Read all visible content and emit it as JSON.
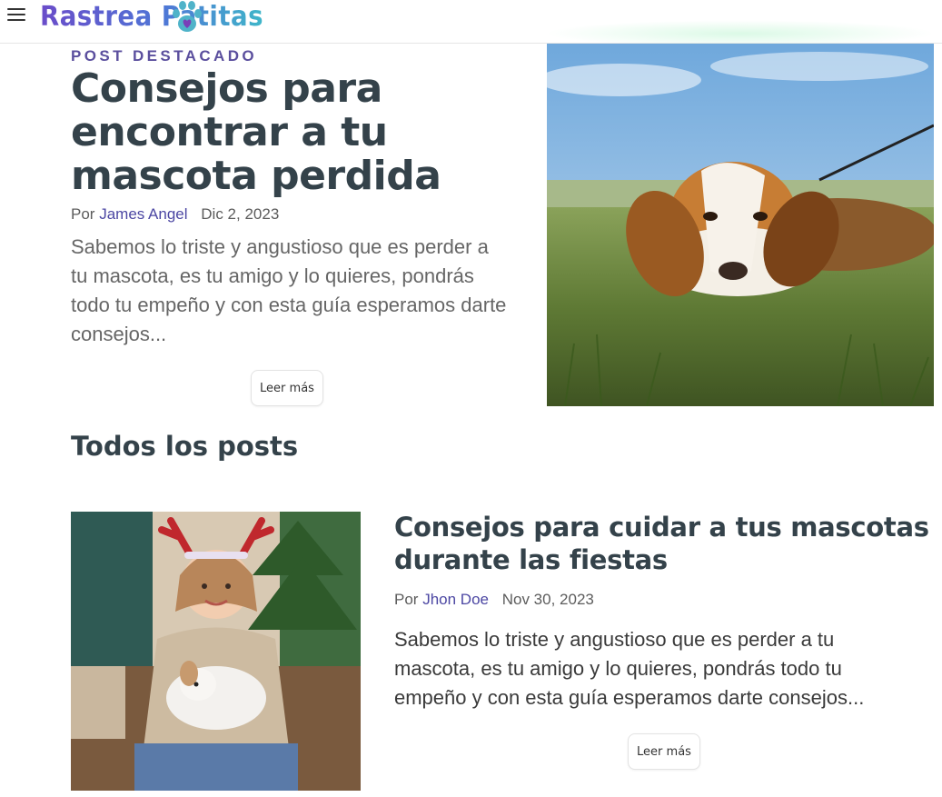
{
  "header": {
    "logo_text": "Rastrea Patitas"
  },
  "featured": {
    "kicker": "POST DESTACADO",
    "title": "Consejos para encontrar a tu mascota perdida",
    "by": "Por",
    "author": "James Angel",
    "date": "Dic 2, 2023",
    "excerpt": "Sabemos lo triste y angustioso que es perder a tu mascota, es tu amigo y lo quieres, pondrás todo tu empeño y con esta guía esperamos darte consejos...",
    "button": "Leer más"
  },
  "all_posts": {
    "title": "Todos los posts",
    "items": [
      {
        "title": "Consejos para cuidar a tus mascotas durante las fiestas",
        "by": "Por",
        "author": "Jhon Doe",
        "date": "Nov 30, 2023",
        "excerpt": "Sabemos lo triste y angustioso que es perder a tu mascota, es tu amigo y lo quieres, pondrás todo tu empeño y con esta guía esperamos darte consejos...",
        "button": "Leer más"
      }
    ]
  },
  "colors": {
    "accent_purple": "#5b4f9e",
    "link": "#4c47a3",
    "heading": "#34424a"
  }
}
